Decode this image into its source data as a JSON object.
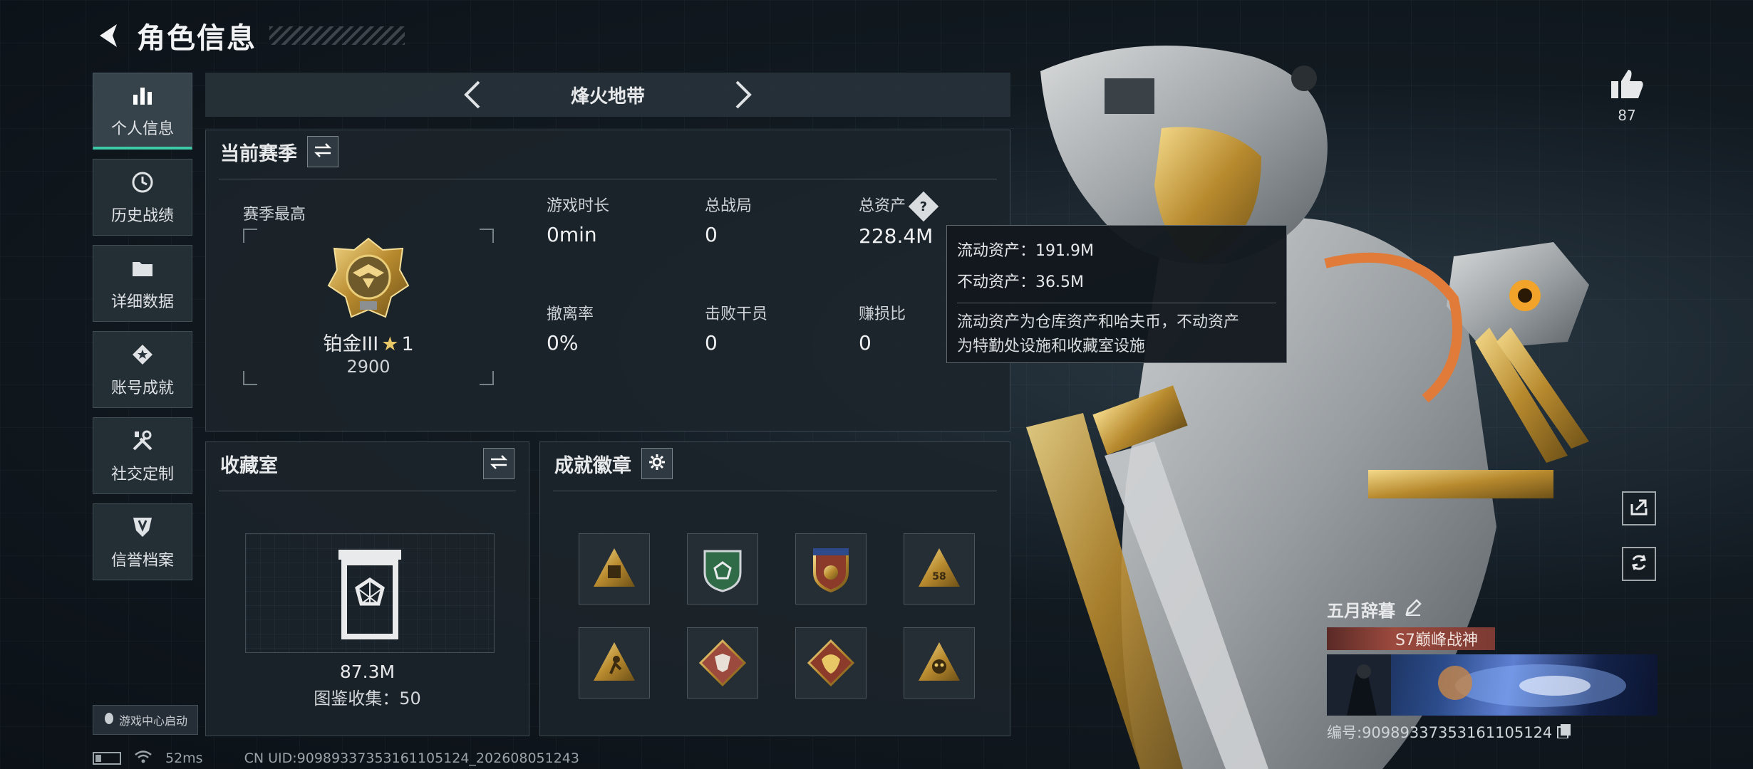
{
  "header": {
    "title": "角色信息"
  },
  "sidebar": {
    "items": [
      {
        "label": "个人信息",
        "icon": "bar-chart-icon",
        "active": true
      },
      {
        "label": "历史战绩",
        "icon": "clock-icon"
      },
      {
        "label": "详细数据",
        "icon": "folder-icon"
      },
      {
        "label": "账号成就",
        "icon": "achievement-icon"
      },
      {
        "label": "社交定制",
        "icon": "tools-icon"
      },
      {
        "label": "信誉档案",
        "icon": "shield-icon"
      }
    ],
    "game_center_label": "游戏中心启动"
  },
  "mode": {
    "title": "烽火地带"
  },
  "season": {
    "title": "当前赛季",
    "best_label": "赛季最高",
    "rank_name": "铂金III",
    "rank_stars": "1",
    "rank_points": "2900",
    "stats": {
      "play_time": {
        "label": "游戏时长",
        "value": "0min"
      },
      "total_matches": {
        "label": "总战局",
        "value": "0"
      },
      "total_assets": {
        "label": "总资产",
        "value": "228.4M"
      },
      "extract_rate": {
        "label": "撤离率",
        "value": "0%"
      },
      "kills": {
        "label": "击败干员",
        "value": "0"
      },
      "profit_ratio": {
        "label": "赚损比",
        "value": "0"
      }
    }
  },
  "tooltip": {
    "liquid": "流动资产：191.9M",
    "fixed": "不动资产：36.5M",
    "desc_line1": "流动资产为仓库资产和哈夫币，不动资产",
    "desc_line2": "为特勤处设施和收藏室设施"
  },
  "collection": {
    "title": "收藏室",
    "value": "87.3M",
    "count_text": "图鉴收集：50"
  },
  "badges": {
    "title": "成就徽章",
    "items": [
      "triangle-badge-icon",
      "green-shield-badge-icon",
      "star-shield-badge-icon",
      "number-badge-icon",
      "climber-badge-icon",
      "wolf-badge-icon",
      "dragon-badge-icon",
      "skull-badge-icon"
    ],
    "number_badge_text": "58"
  },
  "right": {
    "like_count": "87",
    "player_name": "五月辞暮",
    "season_title": "S7巅峰战神",
    "uid_text": "编号:909893373531611051​24"
  },
  "statusbar": {
    "ping": "52ms",
    "uid": "CN UID:909893373531611051​24_202608051243"
  },
  "colors": {
    "accent": "#3ec9a7",
    "gold": "#e8c766",
    "panel": "#1c242b"
  }
}
